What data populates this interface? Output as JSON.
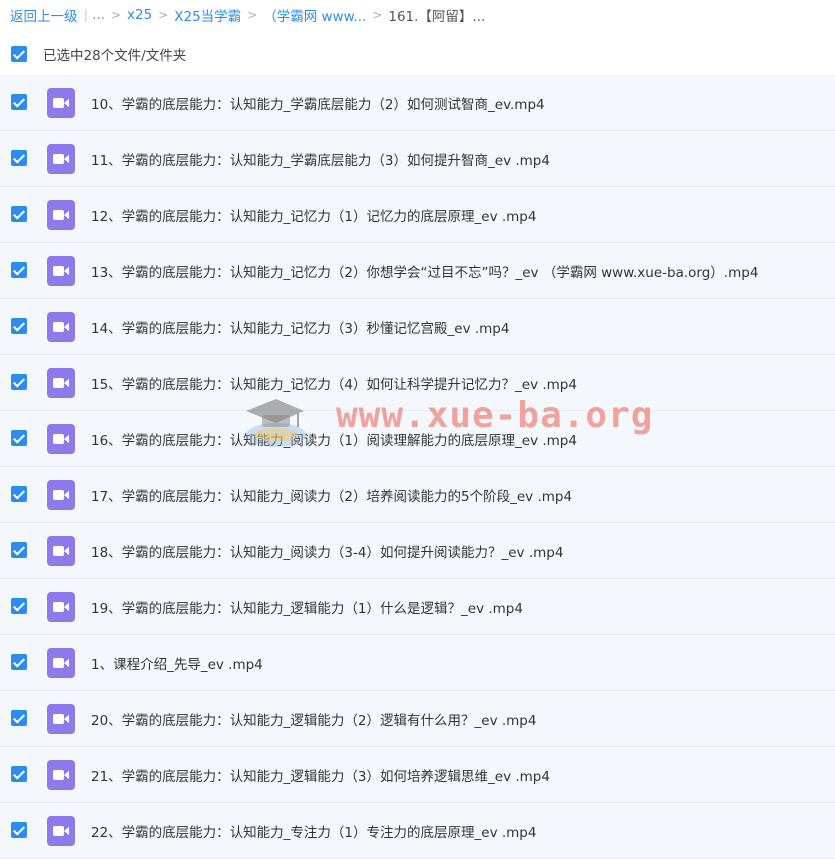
{
  "breadcrumb": {
    "back": "返回上一级",
    "ellipsis": "...",
    "items": [
      "x25",
      "X25当学霸",
      "（学霸网 www...",
      "161.【阿留】..."
    ]
  },
  "selection": {
    "label": "已选中28个文件/文件夹"
  },
  "files": [
    {
      "name": "10、学霸的底层能力：认知能力_学霸底层能力（2）如何测试智商_ev.mp4"
    },
    {
      "name": "11、学霸的底层能力：认知能力_学霸底层能力（3）如何提升智商_ev .mp4"
    },
    {
      "name": "12、学霸的底层能力：认知能力_记忆力（1）记忆力的底层原理_ev .mp4"
    },
    {
      "name": "13、学霸的底层能力：认知能力_记忆力（2）你想学会“过目不忘”吗？_ev （学霸网 www.xue-ba.org）.mp4"
    },
    {
      "name": "14、学霸的底层能力：认知能力_记忆力（3）秒懂记忆宫殿_ev .mp4"
    },
    {
      "name": "15、学霸的底层能力：认知能力_记忆力（4）如何让科学提升记忆力？_ev .mp4"
    },
    {
      "name": "16、学霸的底层能力：认知能力_阅读力（1）阅读理解能力的底层原理_ev .mp4"
    },
    {
      "name": "17、学霸的底层能力：认知能力_阅读力（2）培养阅读能力的5个阶段_ev .mp4"
    },
    {
      "name": "18、学霸的底层能力：认知能力_阅读力（3-4）如何提升阅读能力？_ev .mp4"
    },
    {
      "name": "19、学霸的底层能力：认知能力_逻辑能力（1）什么是逻辑？_ev .mp4"
    },
    {
      "name": "1、课程介绍_先导_ev .mp4"
    },
    {
      "name": "20、学霸的底层能力：认知能力_逻辑能力（2）逻辑有什么用？_ev .mp4"
    },
    {
      "name": "21、学霸的底层能力：认知能力_逻辑能力（3）如何培养逻辑思维_ev .mp4"
    },
    {
      "name": "22、学霸的底层能力：认知能力_专注力（1）专注力的底层原理_ev .mp4"
    }
  ],
  "watermark": {
    "text": "www.xue-ba.org"
  },
  "colors": {
    "accent": "#2d8cf0",
    "video_icon": "#8e7ae8",
    "row_bg": "#f4f8fc",
    "watermark": "#eb3c28"
  }
}
